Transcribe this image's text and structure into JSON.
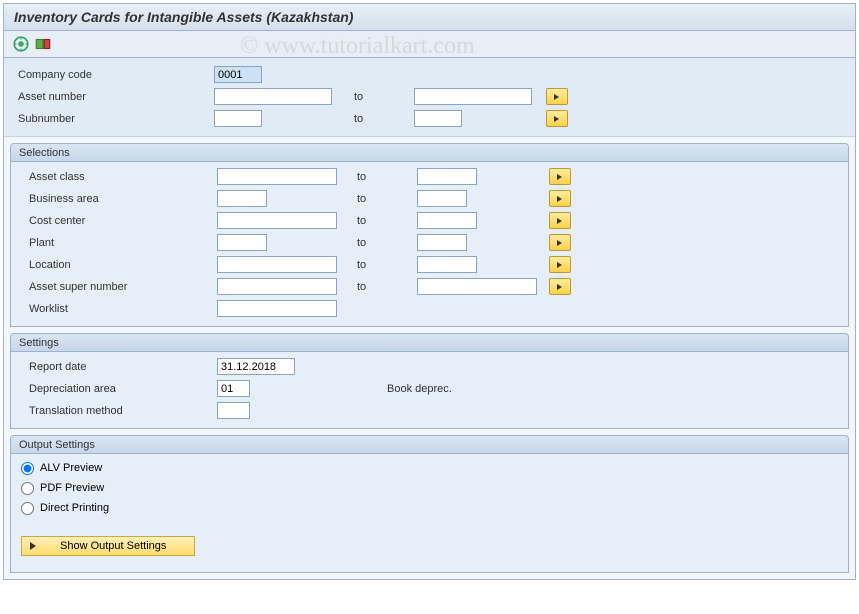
{
  "title": "Inventory Cards for Intangible Assets (Kazakhstan)",
  "watermark": "© www.tutorialkart.com",
  "top": {
    "company_code_label": "Company code",
    "company_code_value": "0001",
    "asset_number_label": "Asset number",
    "asset_number_from": "",
    "asset_number_to": "",
    "subnumber_label": "Subnumber",
    "subnumber_from": "",
    "subnumber_to": "",
    "to_label": "to"
  },
  "selections": {
    "title": "Selections",
    "rows": [
      {
        "label": "Asset class",
        "from": "",
        "to": "",
        "fw": 120,
        "tw": 60,
        "multi": true
      },
      {
        "label": "Business area",
        "from": "",
        "to": "",
        "fw": 50,
        "tw": 50,
        "multi": true
      },
      {
        "label": "Cost center",
        "from": "",
        "to": "",
        "fw": 120,
        "tw": 60,
        "multi": true
      },
      {
        "label": "Plant",
        "from": "",
        "to": "",
        "fw": 50,
        "tw": 50,
        "multi": true
      },
      {
        "label": "Location",
        "from": "",
        "to": "",
        "fw": 120,
        "tw": 60,
        "multi": true
      },
      {
        "label": "Asset super number",
        "from": "",
        "to": "",
        "fw": 120,
        "tw": 120,
        "multi": true
      },
      {
        "label": "Worklist",
        "from": "",
        "to": null,
        "fw": 120,
        "tw": 0,
        "multi": false
      }
    ],
    "to_label": "to"
  },
  "settings": {
    "title": "Settings",
    "report_date_label": "Report date",
    "report_date_value": "31.12.2018",
    "depr_area_label": "Depreciation area",
    "depr_area_value": "01",
    "depr_area_text": "Book deprec.",
    "trans_method_label": "Translation method",
    "trans_method_value": ""
  },
  "output": {
    "title": "Output Settings",
    "options": [
      {
        "label": "ALV Preview",
        "checked": true
      },
      {
        "label": "PDF Preview",
        "checked": false
      },
      {
        "label": "Direct Printing",
        "checked": false
      }
    ],
    "show_button": "Show Output Settings"
  }
}
